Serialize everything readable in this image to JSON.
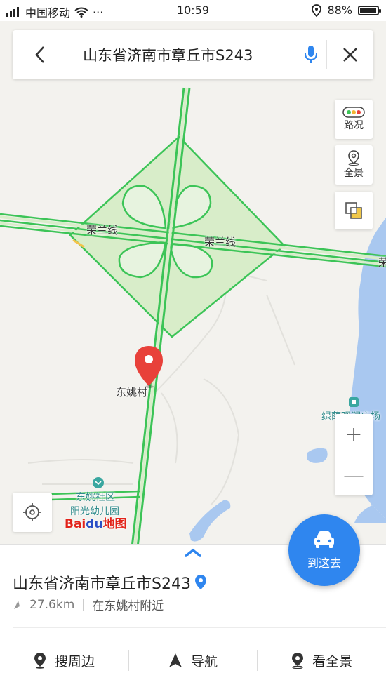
{
  "status_bar": {
    "carrier": "中国移动",
    "dots": "···",
    "time": "10:59",
    "battery": "88%",
    "battery_level": 0.88
  },
  "search": {
    "query": "山东省济南市章丘市S243"
  },
  "map": {
    "road_label_1": "荣兰线",
    "road_label_2": "荣兰线",
    "road_label_edge": "荣",
    "village_label": "东姚村",
    "community_label": "东姚社区",
    "kindergarten_label": "阳光幼儿园",
    "square_label": "绿荫观澜广场"
  },
  "controls": {
    "traffic_label": "路况",
    "panorama_label": "全景",
    "zoom_in": "+",
    "zoom_out": "—"
  },
  "logo": {
    "bai": "Bai",
    "du": "du",
    "ditu": "地图"
  },
  "go_button": {
    "label": "到这去"
  },
  "place": {
    "title": "山东省济南市章丘市S243",
    "distance": "27.6km",
    "nearby": "在东姚村附近"
  },
  "actions": {
    "search_nearby": "搜周边",
    "navigate": "导航",
    "panorama": "看全景"
  },
  "colors": {
    "accent_blue": "#2f86ef",
    "road_green": "#3cc457",
    "interchange_fill": "#d8edc9",
    "water": "#a9c8f0",
    "pin_red": "#e8413a"
  }
}
